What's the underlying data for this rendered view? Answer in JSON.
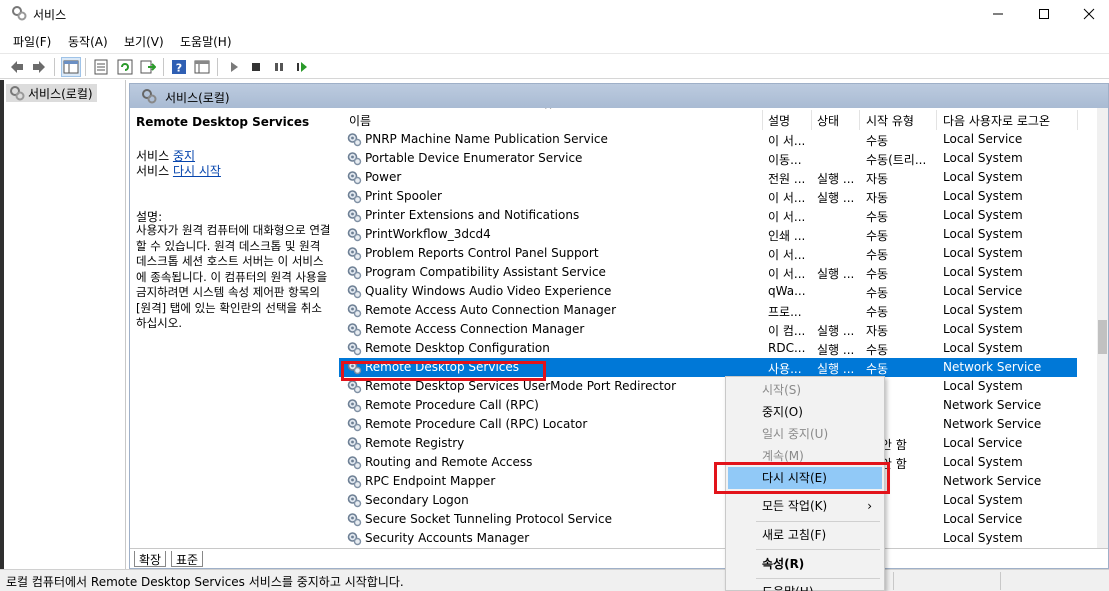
{
  "window": {
    "title": "서비스",
    "controls": {
      "minimize": "minimize",
      "maximize": "maximize",
      "close": "close"
    }
  },
  "menubar": [
    "파일(F)",
    "동작(A)",
    "보기(V)",
    "도움말(H)"
  ],
  "tree": {
    "root": "서비스(로컬)"
  },
  "main": {
    "header_title": "서비스(로컬)",
    "desc": {
      "title": "Remote Desktop Services",
      "action1_prefix": "서비스 ",
      "action1_link": "중지",
      "action2_prefix": "서비스 ",
      "action2_link": "다시 시작",
      "label": "설명:",
      "text": "사용자가 원격 컴퓨터에 대화형으로 연결할 수 있습니다. 원격 데스크톱 및 원격 데스크톱 세션 호스트 서버는 이 서비스에 종속됩니다. 이 컴퓨터의 원격 사용을 금지하려면 시스템 속성 제어판 항목의 [원격] 탭에 있는 확인란의 선택을 취소하십시오."
    },
    "columns": {
      "name": "이름",
      "desc": "설명",
      "status": "상태",
      "startup": "시작 유형",
      "logon": "다음 사용자로 로그온",
      "sort_caret": "^"
    },
    "rows": [
      {
        "name": "PNRP Machine Name Publication Service",
        "desc": "이 서...",
        "status": "",
        "startup": "수동",
        "logon": "Local Service"
      },
      {
        "name": "Portable Device Enumerator Service",
        "desc": "이동...",
        "status": "",
        "startup": "수동(트리...",
        "logon": "Local System"
      },
      {
        "name": "Power",
        "desc": "전원 ...",
        "status": "실행 ...",
        "startup": "자동",
        "logon": "Local System"
      },
      {
        "name": "Print Spooler",
        "desc": "이 서...",
        "status": "실행 ...",
        "startup": "자동",
        "logon": "Local System"
      },
      {
        "name": "Printer Extensions and Notifications",
        "desc": "이 서...",
        "status": "",
        "startup": "수동",
        "logon": "Local System"
      },
      {
        "name": "PrintWorkflow_3dcd4",
        "desc": "인쇄 ...",
        "status": "",
        "startup": "수동",
        "logon": "Local System"
      },
      {
        "name": "Problem Reports Control Panel Support",
        "desc": "이 서...",
        "status": "",
        "startup": "수동",
        "logon": "Local System"
      },
      {
        "name": "Program Compatibility Assistant Service",
        "desc": "이 서...",
        "status": "실행 ...",
        "startup": "수동",
        "logon": "Local System"
      },
      {
        "name": "Quality Windows Audio Video Experience",
        "desc": "qWa...",
        "status": "",
        "startup": "수동",
        "logon": "Local Service"
      },
      {
        "name": "Remote Access Auto Connection Manager",
        "desc": "프로...",
        "status": "",
        "startup": "수동",
        "logon": "Local System"
      },
      {
        "name": "Remote Access Connection Manager",
        "desc": "이 컴...",
        "status": "실행 ...",
        "startup": "자동",
        "logon": "Local System"
      },
      {
        "name": "Remote Desktop Configuration",
        "desc": "RDC...",
        "status": "실행 ...",
        "startup": "수동",
        "logon": "Local System"
      },
      {
        "name": "Remote Desktop Services",
        "desc": "사용...",
        "status": "실행 ...",
        "startup": "수동",
        "logon": "Network Service",
        "selected": true
      },
      {
        "name": "Remote Desktop Services UserMode Port Redirector",
        "desc": "",
        "status": "",
        "startup": "",
        "logon": "Local System"
      },
      {
        "name": "Remote Procedure Call (RPC)",
        "desc": "",
        "status": "",
        "startup": "",
        "logon": "Network Service"
      },
      {
        "name": "Remote Procedure Call (RPC) Locator",
        "desc": "",
        "status": "",
        "startup": "",
        "logon": "Network Service"
      },
      {
        "name": "Remote Registry",
        "desc": "",
        "status": "",
        "startup": "용 안 함",
        "logon": "Local Service"
      },
      {
        "name": "Routing and Remote Access",
        "desc": "",
        "status": "",
        "startup": "용 안 함",
        "logon": "Local System"
      },
      {
        "name": "RPC Endpoint Mapper",
        "desc": "",
        "status": "",
        "startup": "",
        "logon": "Network Service"
      },
      {
        "name": "Secondary Logon",
        "desc": "",
        "status": "",
        "startup": "",
        "logon": "Local System"
      },
      {
        "name": "Secure Socket Tunneling Protocol Service",
        "desc": "",
        "status": "",
        "startup": "",
        "logon": "Local Service"
      },
      {
        "name": "Security Accounts Manager",
        "desc": "",
        "status": "",
        "startup": "",
        "logon": "Local System"
      }
    ]
  },
  "tabs": [
    "확장",
    "표준"
  ],
  "statusbar": {
    "text": "로컬 컴퓨터에서 Remote Desktop Services 서비스를 중지하고 시작합니다."
  },
  "context_menu": {
    "items": [
      {
        "label": "시작(S)",
        "disabled": true
      },
      {
        "label": "중지(O)",
        "disabled": false
      },
      {
        "label": "일시 중지(U)",
        "disabled": true
      },
      {
        "label": "계속(M)",
        "disabled": true
      },
      {
        "label": "다시 시작(E)",
        "disabled": false,
        "hover": true
      },
      {
        "label": "모든 작업(K)",
        "disabled": false,
        "submenu": true
      },
      {
        "label": "새로 고침(F)",
        "disabled": false
      },
      {
        "label": "속성(R)",
        "disabled": false,
        "bold": true
      },
      {
        "label": "도움말(H)",
        "disabled": false
      }
    ],
    "submenu_arrow": "›"
  },
  "colors": {
    "selection": "#0078d7",
    "menu_hover": "#91c9f7",
    "highlight_box": "#e2131a",
    "link": "#0645ad"
  }
}
